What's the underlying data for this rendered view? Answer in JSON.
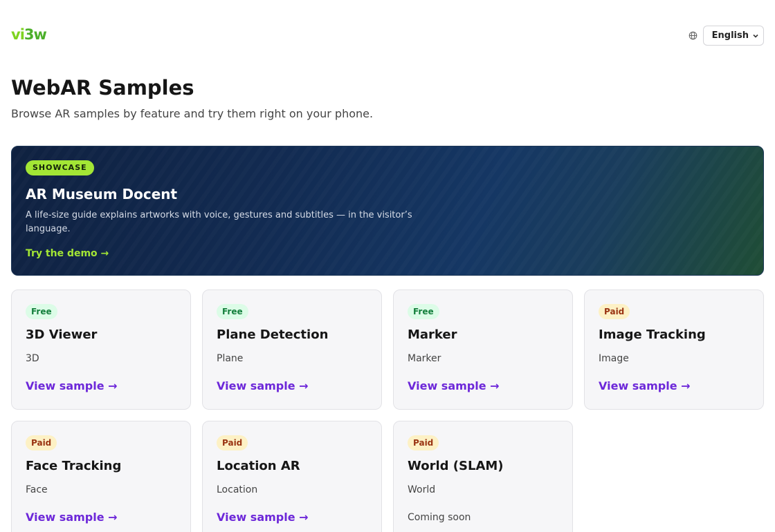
{
  "header": {
    "logo_part1": "vi",
    "logo_part2": "3w",
    "language_icon": "globe-icon",
    "language_selected": "English"
  },
  "page": {
    "title": "WebAR Samples",
    "subtitle": "Browse AR samples by feature and try them right on your phone."
  },
  "showcase": {
    "badge": "SHOWCASE",
    "title": "AR Museum Docent",
    "description": "A life-size guide explains artworks with voice, gestures and subtitles — in the visitor’s language.",
    "cta": "Try the demo →"
  },
  "samples": [
    {
      "tag": "Free",
      "title": "3D Viewer",
      "category": "3D",
      "link": "View sample →"
    },
    {
      "tag": "Free",
      "title": "Plane Detection",
      "category": "Plane",
      "link": "View sample →"
    },
    {
      "tag": "Free",
      "title": "Marker",
      "category": "Marker",
      "link": "View sample →"
    },
    {
      "tag": "Paid",
      "title": "Image Tracking",
      "category": "Image",
      "link": "View sample →"
    },
    {
      "tag": "Paid",
      "title": "Face Tracking",
      "category": "Face",
      "link": "View sample →"
    },
    {
      "tag": "Paid",
      "title": "Location AR",
      "category": "Location",
      "link": "View sample →"
    },
    {
      "tag": "Paid",
      "title": "World (SLAM)",
      "category": "World",
      "status": "Coming soon"
    }
  ],
  "colors": {
    "logo_light": "#7ed321",
    "logo_dark": "#4caf2a",
    "accent_link": "#6d28d9",
    "showcase_accent": "#a3e635",
    "free_badge": "#dcfce7",
    "paid_badge": "#fdf1c5"
  }
}
